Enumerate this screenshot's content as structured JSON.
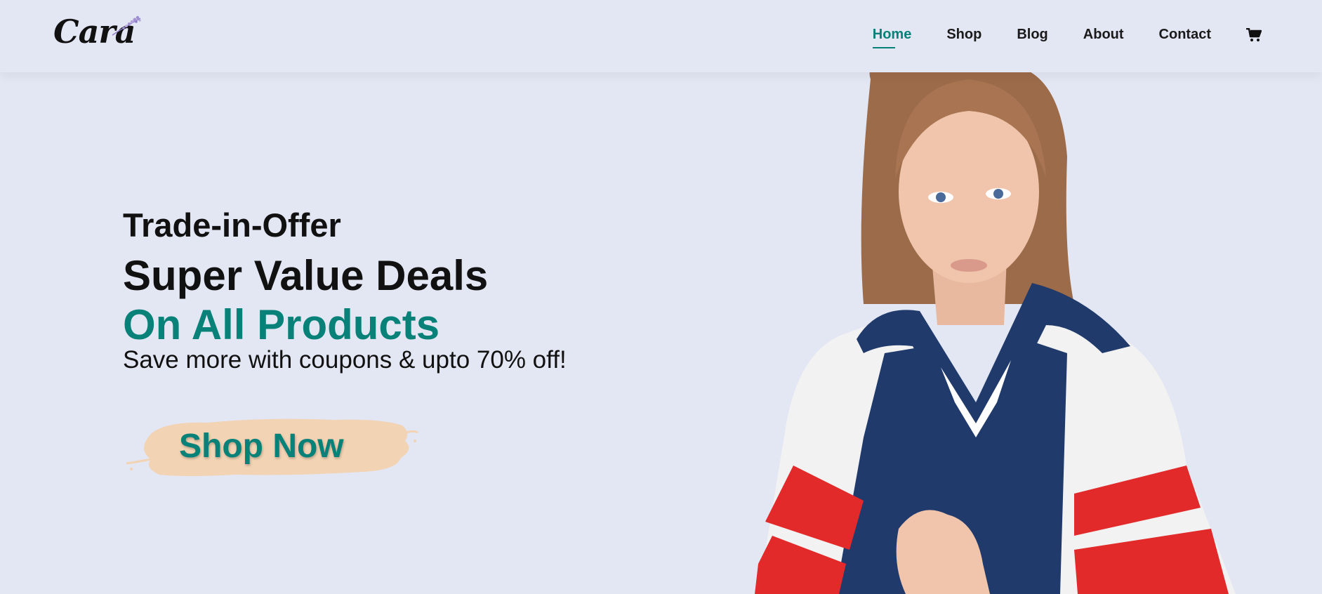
{
  "header": {
    "logo_text": "Cara",
    "nav": [
      {
        "label": "Home",
        "active": true
      },
      {
        "label": "Shop",
        "active": false
      },
      {
        "label": "Blog",
        "active": false
      },
      {
        "label": "About",
        "active": false
      },
      {
        "label": "Contact",
        "active": false
      }
    ],
    "cart_icon": "shopping-cart-icon"
  },
  "hero": {
    "eyebrow": "Trade-in-Offer",
    "headline": "Super Value Deals",
    "headline_accent": "On All Products",
    "subtitle": "Save more with coupons & upto 70% off!",
    "cta_label": "Shop Now"
  },
  "colors": {
    "background": "#e3e6f3",
    "accent": "#088178",
    "cta_brush": "#f2d3b3"
  }
}
